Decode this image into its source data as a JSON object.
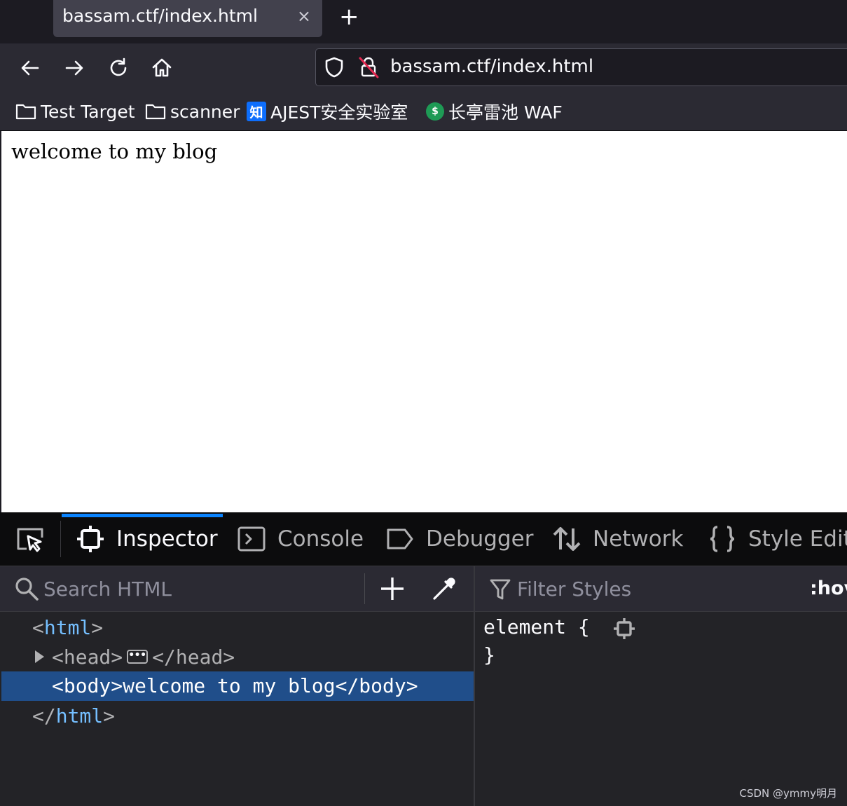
{
  "browser": {
    "tab": {
      "title": "bassam.ctf/index.html",
      "close_glyph": "×"
    },
    "new_tab_glyph": "+",
    "nav": {
      "back_icon": "arrow-left-icon",
      "forward_icon": "arrow-right-icon",
      "reload_icon": "reload-icon",
      "home_icon": "home-icon"
    },
    "url": "bassam.ctf/index.html",
    "bookmarks": [
      {
        "label": "Test Target",
        "icon": "folder-icon"
      },
      {
        "label": "scanner",
        "icon": "folder-icon"
      },
      {
        "label": "AJEST安全实验室",
        "icon": "zhihu-icon",
        "icon_text": "知"
      },
      {
        "label": "长亭雷池 WAF",
        "icon": "chaitin-icon"
      }
    ]
  },
  "page": {
    "body_text": "welcome to my blog"
  },
  "devtools": {
    "tabs": [
      {
        "label": "Inspector",
        "icon": "inspector-icon",
        "active": true
      },
      {
        "label": "Console",
        "icon": "console-icon"
      },
      {
        "label": "Debugger",
        "icon": "debugger-icon"
      },
      {
        "label": "Network",
        "icon": "network-icon"
      },
      {
        "label": "Style Edito",
        "icon": "braces-icon"
      }
    ],
    "search_placeholder": "Search HTML",
    "filter_placeholder": "Filter Styles",
    "pseudo_toggle": ":hov",
    "markup": {
      "html_open": {
        "lt": "<",
        "name": "html",
        "gt": ">"
      },
      "head": {
        "open": "<head>",
        "ellipsis": "•••",
        "close": "</head>"
      },
      "body": {
        "open": "<body>",
        "text": "welcome to my blog",
        "close": "</body>"
      },
      "html_close": {
        "lt": "</",
        "name": "html",
        "gt": ">"
      }
    },
    "rule": {
      "selector": "element",
      "open_brace": "{",
      "close_brace": "}"
    }
  },
  "watermark": "CSDN @ymmy明月",
  "colors": {
    "accent": "#0a84ff",
    "selection": "#204e8a",
    "toolbar": "#2b2a33",
    "background": "#1c1b22"
  }
}
